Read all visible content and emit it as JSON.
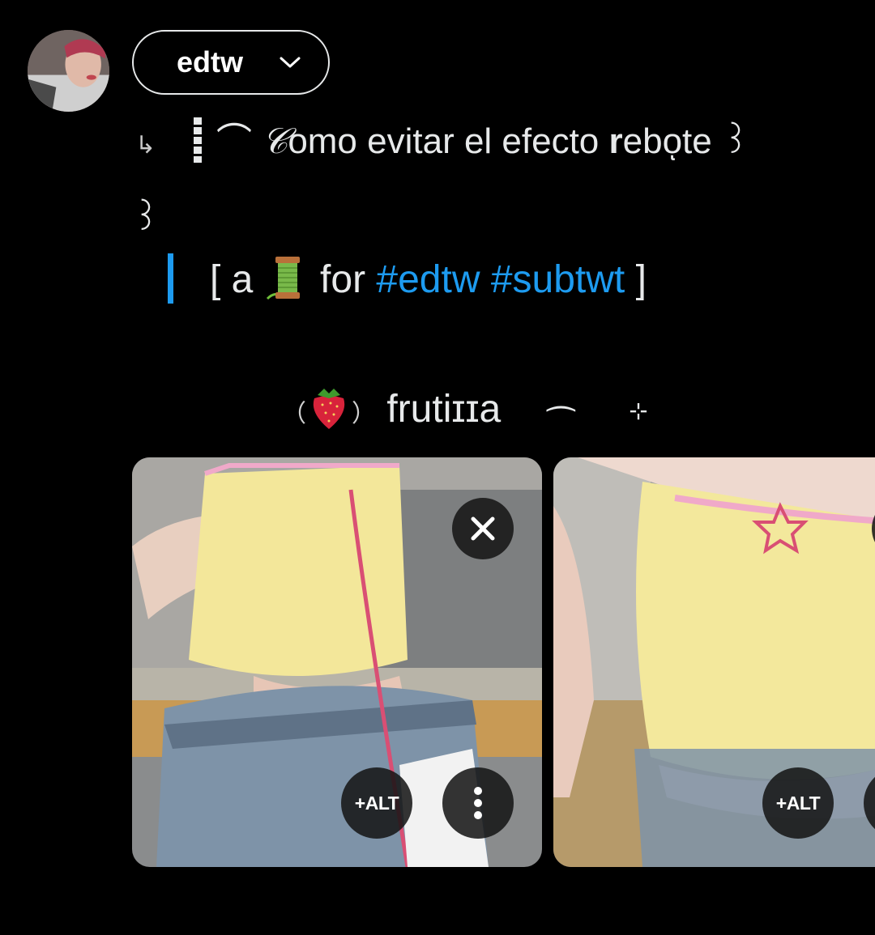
{
  "account": {
    "name": "edtw",
    "avatar_icon": "avatar-photo"
  },
  "post": {
    "line1_arrow": "↳",
    "line1_arc": "⌒",
    "line1_script_c": "𝒞",
    "line1_text_a": "omo evitar el efecto ",
    "line1_bold_r": "r",
    "line1_text_b": "eboͅte ꒱",
    "line2": "꒱",
    "line3_open": "[ a ",
    "line3_for": " for ",
    "hashtag1": "#edtw",
    "hashtag2": "#subtwt",
    "line3_close": " ]",
    "line4_open": "（",
    "line4_close": "）",
    "line4_word": "frutiɪɪa",
    "line4_arc": "⁀",
    "line4_spark": "⊹"
  },
  "media": {
    "alt_label": "+ALT",
    "close_icon": "close-icon",
    "more_icon": "more-vertical-icon"
  },
  "colors": {
    "background": "#000000",
    "text": "#e7e9ea",
    "accent": "#1d9bf0"
  }
}
